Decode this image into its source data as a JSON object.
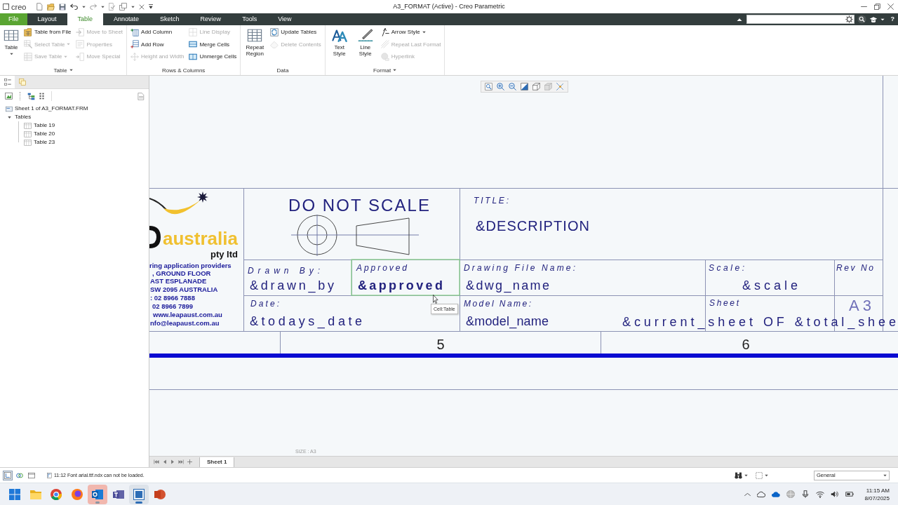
{
  "window": {
    "logo": "creo",
    "title": "A3_FORMAT (Active) - Creo Parametric"
  },
  "tabs": [
    {
      "label": "File",
      "kind": "file",
      "selected": false
    },
    {
      "label": "Layout",
      "kind": "tab",
      "selected": false
    },
    {
      "label": "Table",
      "kind": "tab",
      "selected": true
    },
    {
      "label": "Annotate",
      "kind": "tab",
      "selected": false
    },
    {
      "label": "Sketch",
      "kind": "tab",
      "selected": false
    },
    {
      "label": "Review",
      "kind": "tab",
      "selected": false
    },
    {
      "label": "Tools",
      "kind": "tab",
      "selected": false
    },
    {
      "label": "View",
      "kind": "tab",
      "selected": false
    }
  ],
  "help": "?",
  "ribbon": {
    "groups": [
      {
        "label": "Table",
        "menu": true,
        "items": [
          {
            "kind": "large",
            "label": "Table",
            "dropdown": true,
            "disabled": false
          },
          {
            "kind": "small",
            "label": "Table from File",
            "dropdown": false,
            "disabled": false
          },
          {
            "kind": "small",
            "label": "Select Table",
            "dropdown": true,
            "disabled": true
          },
          {
            "kind": "small",
            "label": "Save Table",
            "dropdown": true,
            "disabled": true
          },
          {
            "kind": "small",
            "label": "Move to Sheet",
            "dropdown": false,
            "disabled": true
          },
          {
            "kind": "small",
            "label": "Properties",
            "dropdown": false,
            "disabled": true
          },
          {
            "kind": "small",
            "label": "Move Special",
            "dropdown": false,
            "disabled": true
          }
        ]
      },
      {
        "label": "Rows & Columns",
        "menu": false,
        "items": [
          {
            "kind": "small",
            "label": "Add Column",
            "dropdown": false,
            "disabled": false
          },
          {
            "kind": "small",
            "label": "Add Row",
            "dropdown": false,
            "disabled": false
          },
          {
            "kind": "small",
            "label": "Height and Width",
            "dropdown": false,
            "disabled": true
          },
          {
            "kind": "small",
            "label": "Line Display",
            "dropdown": false,
            "disabled": true
          },
          {
            "kind": "small",
            "label": "Merge Cells",
            "dropdown": false,
            "disabled": false
          },
          {
            "kind": "small",
            "label": "Unmerge Cells",
            "dropdown": false,
            "disabled": false
          }
        ]
      },
      {
        "label": "Data",
        "menu": false,
        "items": [
          {
            "kind": "large",
            "label": "Repeat Region",
            "dropdown": false,
            "disabled": false
          },
          {
            "kind": "small",
            "label": "Update Tables",
            "dropdown": false,
            "disabled": false
          },
          {
            "kind": "small",
            "label": "Delete Contents",
            "dropdown": false,
            "disabled": true
          }
        ]
      },
      {
        "label": "Format",
        "menu": true,
        "items": [
          {
            "kind": "large",
            "label": "Text Style",
            "dropdown": false,
            "disabled": false
          },
          {
            "kind": "large",
            "label": "Line Style",
            "dropdown": false,
            "disabled": false
          },
          {
            "kind": "small",
            "label": "Arrow Style",
            "dropdown": true,
            "disabled": false
          },
          {
            "kind": "small",
            "label": "Repeat Last Format",
            "dropdown": false,
            "disabled": true
          },
          {
            "kind": "small",
            "label": "Hyperlink",
            "dropdown": false,
            "disabled": true
          }
        ]
      }
    ]
  },
  "model_tree": {
    "tabs": [
      {
        "selected": true
      },
      {
        "selected": false
      }
    ],
    "items": [
      {
        "kind": "sheet",
        "label": "Sheet 1 of A3_FORMAT.FRM"
      },
      {
        "kind": "group",
        "label": "Tables",
        "expanded": true,
        "children": [
          {
            "label": "Table 19"
          },
          {
            "label": "Table 20"
          },
          {
            "label": "Table 23"
          }
        ]
      }
    ]
  },
  "drawing": {
    "notice": "DO NOT SCALE",
    "company": {
      "name": "australia",
      "suffix": "pty ltd",
      "lines": [
        "ring application providers",
        ", GROUND FLOOR",
        "AST ESPLANADE",
        "SW 2095 AUSTRALIA",
        ": 02 8966 7888",
        "02 8966 7899",
        "www.leapaust.com.au",
        "nfo@leapaust.com.au"
      ]
    },
    "title": {
      "label": "TITLE:",
      "value": "&DESCRIPTION"
    },
    "cells": [
      {
        "label": "Drawn By:",
        "value": "&drawn_by",
        "selected": false
      },
      {
        "label": "Approved",
        "value": "&approved",
        "selected": true
      },
      {
        "label": "Drawing File Name:",
        "value": "&dwg_name",
        "selected": false
      },
      {
        "label": "Scale:",
        "value": "&scale",
        "selected": false
      },
      {
        "label": "Rev No",
        "selected": false
      },
      {
        "label": "Date:",
        "value": "&todays_date",
        "selected": false
      },
      {
        "label": "Model Name:",
        "value": "&model_name",
        "selected": false
      },
      {
        "label": "Sheet",
        "selected": false
      }
    ],
    "sheet_text": "&current_sheet OF &total_shee",
    "size_mark": "A3",
    "zones": [
      "5",
      "6"
    ],
    "size_label": "SIZE : A3",
    "tooltip": "Cell:Table"
  },
  "sheet_tabs": [
    {
      "label": "Sheet 1",
      "selected": true
    }
  ],
  "status_bar": {
    "toggles": [
      {
        "on": true
      },
      {
        "on": false
      },
      {
        "on": false
      }
    ],
    "message": "11:12 Font arial.ttf.ndx can not be loaded.",
    "filter": "General"
  },
  "taskbar": {
    "apps": [
      {
        "selected": false,
        "attention": false,
        "running": false
      },
      {
        "selected": false,
        "attention": false,
        "running": false
      },
      {
        "selected": false,
        "attention": false,
        "running": false
      },
      {
        "selected": false,
        "attention": true,
        "running": true
      },
      {
        "selected": false,
        "attention": false,
        "running": false
      },
      {
        "selected": true,
        "attention": false,
        "running": true
      },
      {
        "selected": false,
        "attention": false,
        "running": false
      }
    ],
    "time": "11:15 AM",
    "date": "8/07/2025"
  }
}
